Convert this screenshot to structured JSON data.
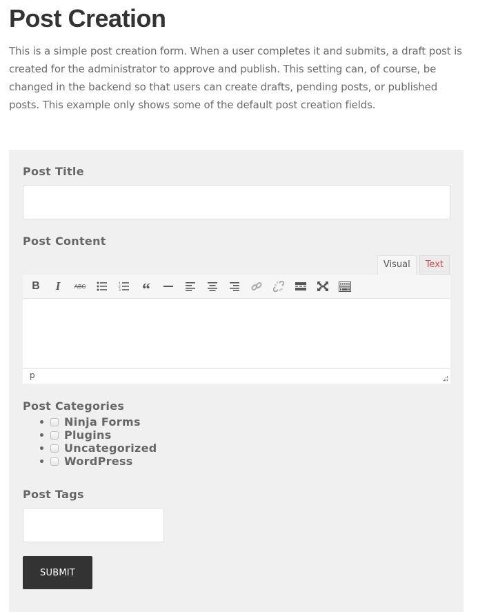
{
  "page": {
    "title": "Post Creation",
    "intro": "This is a simple post creation form. When a user completes it and submits, a draft post is created for the administrator to approve and publish. This setting can, of course, be changed in the backend so that users can create drafts, pending posts, or published posts. This example only shows some of the default post creation fields."
  },
  "form": {
    "post_title": {
      "label": "Post Title",
      "value": ""
    },
    "post_content": {
      "label": "Post Content",
      "tabs": [
        {
          "label": "Visual",
          "active": true
        },
        {
          "label": "Text",
          "active": false
        }
      ],
      "toolbar": [
        {
          "name": "bold",
          "icon": "bold-icon"
        },
        {
          "name": "italic",
          "icon": "italic-icon"
        },
        {
          "name": "strikethrough",
          "icon": "strikethrough-icon"
        },
        {
          "name": "bulleted-list",
          "icon": "bulleted-list-icon"
        },
        {
          "name": "numbered-list",
          "icon": "numbered-list-icon"
        },
        {
          "name": "blockquote",
          "icon": "blockquote-icon"
        },
        {
          "name": "horizontal-line",
          "icon": "horizontal-line-icon"
        },
        {
          "name": "align-left",
          "icon": "align-left-icon"
        },
        {
          "name": "align-center",
          "icon": "align-center-icon"
        },
        {
          "name": "align-right",
          "icon": "align-right-icon"
        },
        {
          "name": "insert-link",
          "icon": "link-icon"
        },
        {
          "name": "remove-link",
          "icon": "unlink-icon"
        },
        {
          "name": "read-more",
          "icon": "read-more-icon"
        },
        {
          "name": "fullscreen",
          "icon": "fullscreen-icon"
        },
        {
          "name": "toolbar-toggle",
          "icon": "keyboard-icon"
        }
      ],
      "value": "",
      "path": "p"
    },
    "post_categories": {
      "label": "Post Categories",
      "options": [
        {
          "label": "Ninja Forms",
          "checked": false
        },
        {
          "label": "Plugins",
          "checked": false
        },
        {
          "label": "Uncategorized",
          "checked": false
        },
        {
          "label": "WordPress",
          "checked": false
        }
      ]
    },
    "post_tags": {
      "label": "Post Tags",
      "value": ""
    },
    "submit_label": "SUBMIT"
  }
}
